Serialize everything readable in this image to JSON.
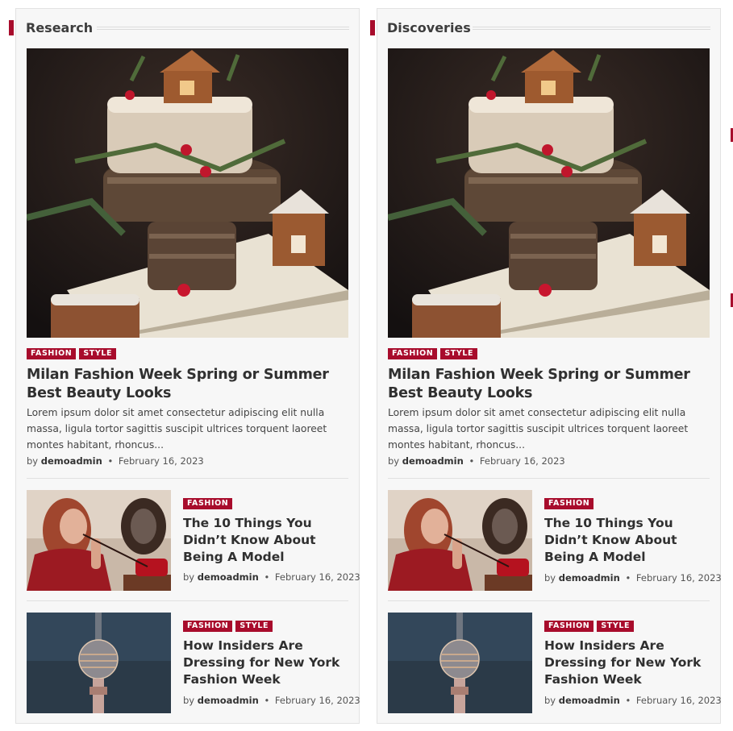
{
  "theme": {
    "accent": "#a80c2c",
    "panel_bg": "#f7f7f7",
    "text": "#303030"
  },
  "columns": [
    {
      "section_title": "Research",
      "main_post": {
        "image": "christmas-cake-gingerbread-house-photo",
        "categories": [
          "FASHION",
          "STYLE"
        ],
        "title": "Milan Fashion Week Spring or Summer Best Beauty Looks",
        "excerpt": "Lorem ipsum dolor sit amet consectetur adipiscing elit nulla massa, ligula tortor sagittis suscipit ultrices torquent laoreet montes habitant, rhoncus...",
        "by": "by",
        "author": "demoadmin",
        "date": "February 16, 2023"
      },
      "posts": [
        {
          "image": "woman-red-telephone-photo",
          "categories": [
            "FASHION"
          ],
          "title": "The 10 Things You Didn’t Know About Being A Model",
          "by": "by",
          "author": "demoadmin",
          "date": "February 16, 2023"
        },
        {
          "image": "tv-tower-photo",
          "categories": [
            "FASHION",
            "STYLE"
          ],
          "title": "How Insiders Are Dressing for New York Fashion Week",
          "by": "by",
          "author": "demoadmin",
          "date": "February 16, 2023"
        }
      ]
    },
    {
      "section_title": "Discoveries",
      "main_post": {
        "image": "christmas-cake-gingerbread-house-photo",
        "categories": [
          "FASHION",
          "STYLE"
        ],
        "title": "Milan Fashion Week Spring or Summer Best Beauty Looks",
        "excerpt": "Lorem ipsum dolor sit amet consectetur adipiscing elit nulla massa, ligula tortor sagittis suscipit ultrices torquent laoreet montes habitant, rhoncus...",
        "by": "by",
        "author": "demoadmin",
        "date": "February 16, 2023"
      },
      "posts": [
        {
          "image": "woman-red-telephone-photo",
          "categories": [
            "FASHION"
          ],
          "title": "The 10 Things You Didn’t Know About Being A Model",
          "by": "by",
          "author": "demoadmin",
          "date": "February 16, 2023"
        },
        {
          "image": "tv-tower-photo",
          "categories": [
            "FASHION",
            "STYLE"
          ],
          "title": "How Insiders Are Dressing for New York Fashion Week",
          "by": "by",
          "author": "demoadmin",
          "date": "February 16, 2023"
        }
      ]
    }
  ]
}
